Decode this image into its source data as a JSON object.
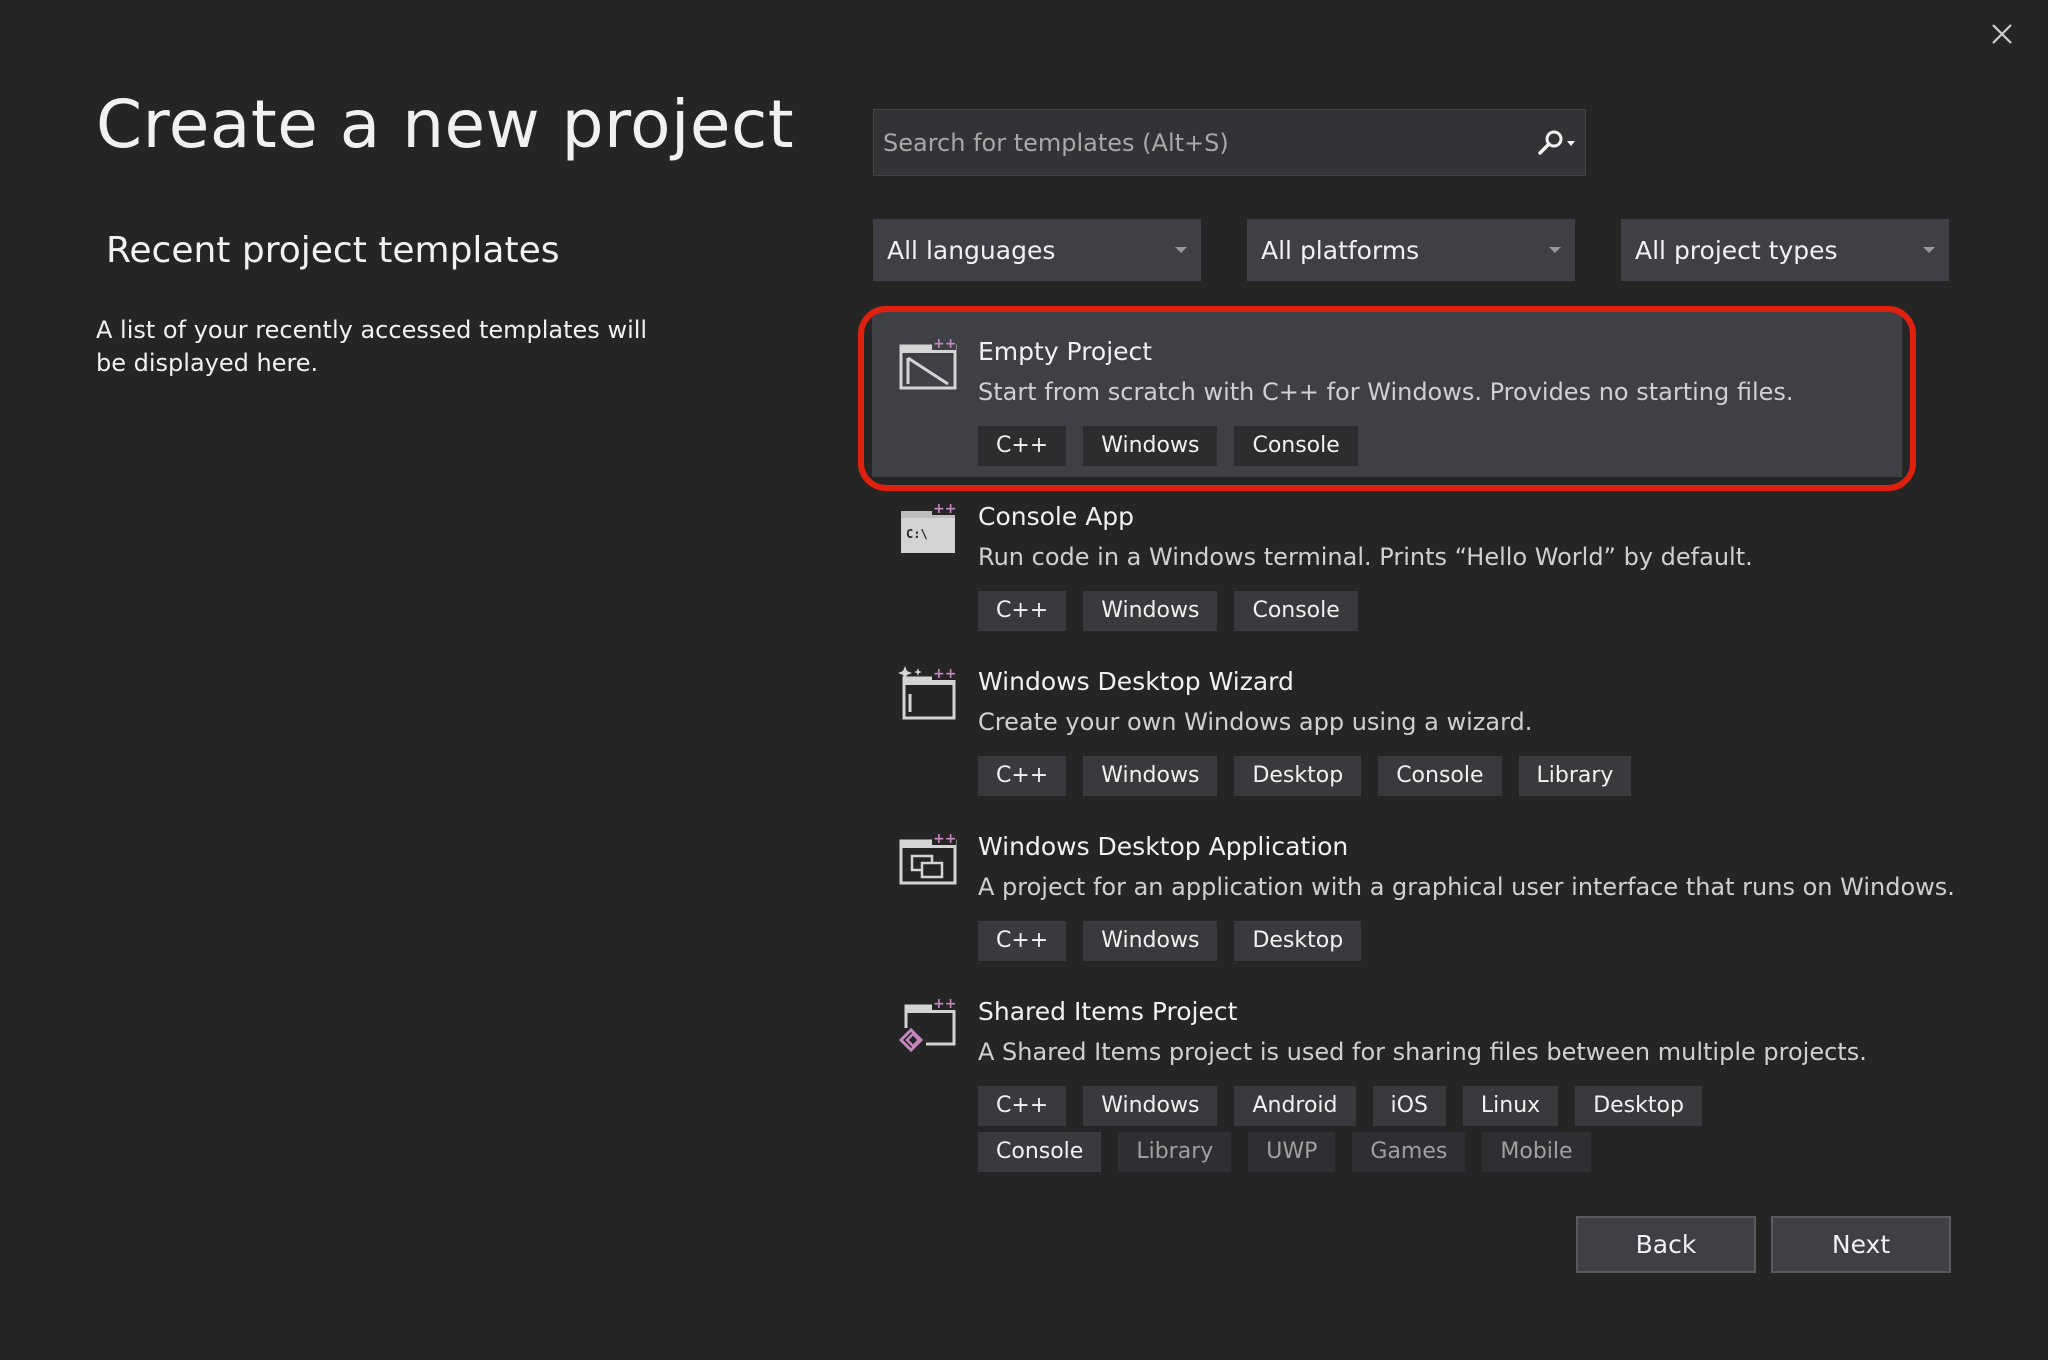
{
  "header": {
    "title": "Create a new project",
    "close_icon": "close-icon"
  },
  "recent": {
    "heading": "Recent project templates",
    "empty_message": "A list of your recently accessed templates will be displayed here."
  },
  "search": {
    "placeholder": "Search for templates (Alt+S)",
    "value": "",
    "icon": "search-icon"
  },
  "filters": [
    {
      "label": "All languages"
    },
    {
      "label": "All platforms"
    },
    {
      "label": "All project types"
    }
  ],
  "templates": [
    {
      "name": "Empty Project",
      "description": "Start from scratch with C++ for Windows. Provides no starting files.",
      "icon": "empty-project-icon",
      "selected": true,
      "tags": [
        "C++",
        "Windows",
        "Console"
      ]
    },
    {
      "name": "Console App",
      "description": "Run code in a Windows terminal. Prints “Hello World” by default.",
      "icon": "console-app-icon",
      "icon_text": "C:\\",
      "tags": [
        "C++",
        "Windows",
        "Console"
      ]
    },
    {
      "name": "Windows Desktop Wizard",
      "description": "Create your own Windows app using a wizard.",
      "icon": "wizard-icon",
      "tags": [
        "C++",
        "Windows",
        "Desktop",
        "Console",
        "Library"
      ]
    },
    {
      "name": "Windows Desktop Application",
      "description": "A project for an application with a graphical user interface that runs on Windows.",
      "icon": "desktop-app-icon",
      "tags": [
        "C++",
        "Windows",
        "Desktop"
      ]
    },
    {
      "name": "Shared Items Project",
      "description": "A Shared Items project is used for sharing files between multiple projects.",
      "icon": "shared-items-icon",
      "tags": [
        "C++",
        "Windows",
        "Android",
        "iOS",
        "Linux",
        "Desktop",
        "Console"
      ],
      "more_tags": [
        "Library",
        "UWP",
        "Games",
        "Mobile"
      ]
    }
  ],
  "footer": {
    "back_label": "Back",
    "next_label": "Next"
  },
  "colors": {
    "background": "#252526",
    "selected_row": "#3f3f46",
    "highlight_ring": "#e0200e",
    "cpp_plus": "#c586c0"
  }
}
